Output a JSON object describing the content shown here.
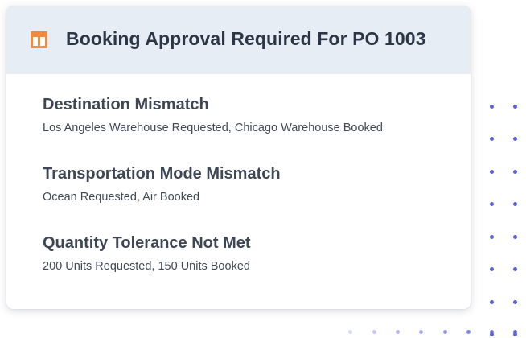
{
  "card": {
    "title": "Booking Approval Required For PO 1003",
    "icon": "document-bars-icon",
    "accent_color": "#f08a3c",
    "header_bg": "#e7edf4"
  },
  "issues": [
    {
      "title": "Destination Mismatch",
      "detail": "Los Angeles Warehouse Requested, Chicago Warehouse Booked"
    },
    {
      "title": "Transportation Mode Mismatch",
      "detail": "Ocean Requested, Air Booked"
    },
    {
      "title": "Quantity Tolerance Not Met",
      "detail": "200 Units Requested, 150 Units Booked"
    }
  ],
  "decoration": {
    "dot_color": "#5a64d6"
  }
}
